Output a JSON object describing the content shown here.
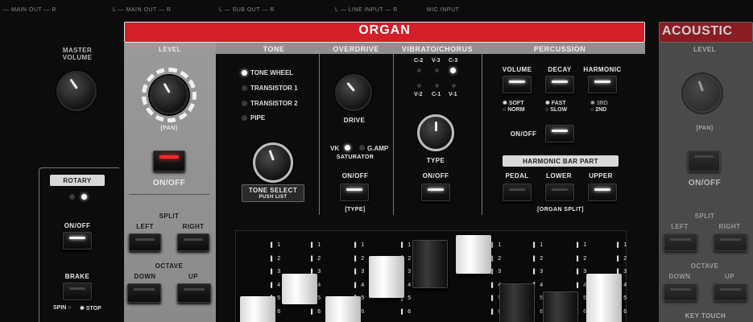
{
  "top_labels": {
    "main_out": "L — MAIN OUT — R",
    "main_out_left": "— MAIN OUT — R",
    "sub_out": "L — SUB OUT — R",
    "line_input": "L — LINE INPUT — R",
    "mic_input": "MIC INPUT"
  },
  "left": {
    "master_volume_1": "MASTER",
    "master_volume_2": "VOLUME",
    "rotary_title": "ROTARY",
    "on_off": "ON/OFF",
    "brake": "BRAKE",
    "spin": "SPIN",
    "stop": "STOP"
  },
  "organ": {
    "title": "ORGAN",
    "level": "LEVEL",
    "pan": "[PAN]",
    "on_off": "ON/OFF",
    "split": "SPLIT",
    "split_left": "LEFT",
    "split_right": "RIGHT",
    "octave": "OCTAVE",
    "octave_down": "DOWN",
    "octave_up": "UP",
    "tone": {
      "title": "TONE",
      "options": [
        "TONE WHEEL",
        "TRANSISTOR 1",
        "TRANSISTOR 2",
        "PIPE"
      ],
      "select_1": "TONE SELECT",
      "select_2": "PUSH LIST"
    },
    "overdrive": {
      "title": "OVERDRIVE",
      "drive": "DRIVE",
      "vk": "VK",
      "gamp": "G.AMP",
      "saturator": "SATURATOR",
      "on_off": "ON/OFF",
      "type": "[TYPE]"
    },
    "vibrato": {
      "title": "VIBRATO/CHORUS",
      "top": [
        "C-2",
        "V-3",
        "C-3"
      ],
      "bottom": [
        "V-2",
        "C-1",
        "V-1"
      ],
      "type": "TYPE",
      "on_off": "ON/OFF"
    },
    "percussion": {
      "title": "PERCUSSION",
      "volume": "VOLUME",
      "decay": "DECAY",
      "harmonic": "HARMONIC",
      "soft": "SOFT",
      "norm": "NORM",
      "fast": "FAST",
      "slow": "SLOW",
      "third": "3RD",
      "second": "2ND",
      "on_off": "ON/OFF"
    },
    "harmonic_bar": {
      "title": "HARMONIC BAR PART",
      "pedal": "PEDAL",
      "lower": "LOWER",
      "upper": "UPPER",
      "organ_split": "[ORGAN SPLIT]"
    },
    "drawbar_numbers": [
      "1",
      "2",
      "3",
      "4",
      "5",
      "6"
    ]
  },
  "acoustic": {
    "title": "ACOUSTIC",
    "level": "LEVEL",
    "pan": "[PAN]",
    "on_off": "ON/OFF",
    "split": "SPLIT",
    "split_left": "LEFT",
    "split_right": "RIGHT",
    "octave": "OCTAVE",
    "octave_down": "DOWN",
    "octave_up": "UP",
    "key_touch": "KEY TOUCH"
  },
  "colors": {
    "organ_red": "#d21f2a",
    "panel_grey": "#8f8f8f",
    "led_white": "#ffffff",
    "led_red": "#ff2a2a"
  }
}
